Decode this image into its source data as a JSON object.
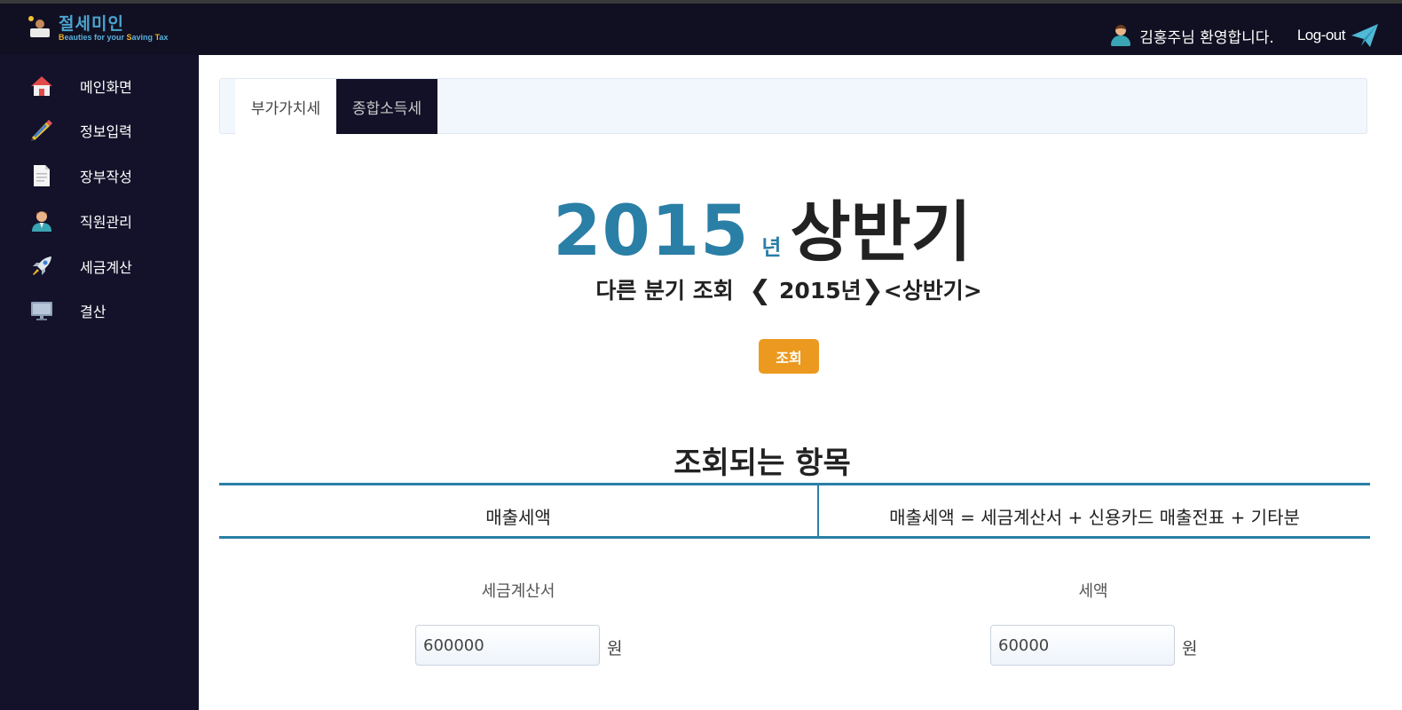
{
  "header": {
    "logo_title": "절세미인",
    "logo_subtitle_parts": [
      "B",
      "eauties for your ",
      "S",
      "aving ",
      "T",
      "ax"
    ],
    "welcome": "김홍주님 환영합니다.",
    "logout": "Log-out"
  },
  "sidebar": {
    "items": [
      {
        "label": "메인화면",
        "icon": "house-icon"
      },
      {
        "label": "정보입력",
        "icon": "pencil-icon"
      },
      {
        "label": "장부작성",
        "icon": "document-icon"
      },
      {
        "label": "직원관리",
        "icon": "person-icon"
      },
      {
        "label": "세금계산",
        "icon": "rocket-icon"
      },
      {
        "label": "결산",
        "icon": "monitor-icon"
      }
    ]
  },
  "tabs": [
    {
      "label": "부가가치세",
      "active": false
    },
    {
      "label": "종합소득세",
      "active": true
    }
  ],
  "hero": {
    "year": "2015",
    "year_unit": "년",
    "half": "상반기"
  },
  "period_selector": {
    "label": "다른 분기 조회",
    "year": "2015년",
    "half": "<상반기>",
    "prev_arrow": "❮",
    "next_arrow": "❯"
  },
  "query_button": "조회",
  "section_title": "조회되는 항목",
  "items_table": {
    "left": "매출세액",
    "right": "매출세액 = 세금계산서 + 신용카드 매출전표 + 기타분"
  },
  "fields": [
    {
      "label": "세금계산서",
      "value": "600000",
      "unit": "원"
    },
    {
      "label": "세액",
      "value": "60000",
      "unit": "원"
    }
  ],
  "colors": {
    "sidebar_bg": "#13122a",
    "accent_blue": "#2a7fa6",
    "button_orange": "#eb9a1f"
  }
}
